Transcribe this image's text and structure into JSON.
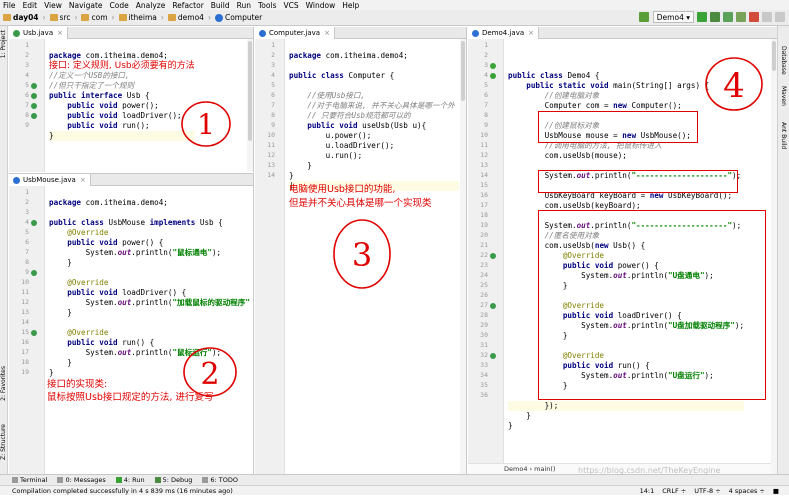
{
  "menu": [
    "File",
    "Edit",
    "View",
    "Navigate",
    "Code",
    "Analyze",
    "Refactor",
    "Build",
    "Run",
    "Tools",
    "VCS",
    "Window",
    "Help"
  ],
  "breadcrumbs": [
    "day04",
    "src",
    "com",
    "itheima",
    "demo4",
    "Computer"
  ],
  "run_config": "Demo4 ▾",
  "left_strip": {
    "project": "1: Project",
    "structure": "Z: Structure",
    "favorites": "2: Favorites"
  },
  "right_strip": {
    "database": "Database",
    "maven": "Maven",
    "ant": "Ant Build"
  },
  "pane1": {
    "tab": "Usb.java",
    "lines": [
      "1",
      "2",
      "3",
      "4",
      "5",
      "6",
      "7",
      "8",
      "9"
    ],
    "code": {
      "l1a": "package ",
      "l1b": "com.itheima.demo4;",
      "l2": "接口: 定义规则, Usb必须要有的方法",
      "l3": "//定义一个USB的接口,",
      "l4": "//但只干指定了一个规则",
      "l5a": "public interface ",
      "l5b": "Usb {",
      "l6a": "    public void ",
      "l6b": "power();",
      "l7a": "    public void ",
      "l7b": "loadDriver();",
      "l8a": "    public void ",
      "l8b": "run();",
      "l9": "}"
    }
  },
  "pane2": {
    "tab": "UsbMouse.java",
    "lines": [
      "1",
      "2",
      "3",
      "4",
      "5",
      "6",
      "7",
      "8",
      "9",
      "10",
      "11",
      "12",
      "13",
      "14",
      "15",
      "16",
      "17",
      "18",
      "19"
    ],
    "code": {
      "l1a": "package ",
      "l1b": "com.itheima.demo4;",
      "l3a": "public class ",
      "l3b": "UsbMouse ",
      "l3c": "implements ",
      "l3d": "Usb {",
      "l4": "    @Override",
      "l5a": "    public void ",
      "l5b": "power() {",
      "l6a": "        System.",
      "l6b": "out",
      "l6c": ".println(",
      "l6d": "\"鼠标通电\"",
      "l6e": ");",
      "l7": "    }",
      "l9": "    @Override",
      "l10a": "    public void ",
      "l10b": "loadDriver() {",
      "l11a": "        System.",
      "l11b": "out",
      "l11c": ".println(",
      "l11d": "\"加载鼠标的驱动程序\"",
      "l12": "    }",
      "l14": "    @Override",
      "l15a": "    public void ",
      "l15b": "run() {",
      "l16a": "        System.",
      "l16b": "out",
      "l16c": ".println(",
      "l16d": "\"鼠标运行\"",
      "l16e": ");",
      "l17": "    }",
      "l18": "}"
    },
    "annot1": "接口的实现类:",
    "annot2": "鼠标按照Usb接口规定的方法, 进行复写"
  },
  "pane3": {
    "tab": "Computer.java",
    "lines": [
      "1",
      "2",
      "3",
      "4",
      "5",
      "6",
      "7",
      "8",
      "9",
      "10",
      "11",
      "12",
      "13",
      "14"
    ],
    "code": {
      "l1a": "package ",
      "l1b": "com.itheima.demo4;",
      "l3a": "public class ",
      "l3b": "Computer {",
      "l5": "    //使用Usb接口,",
      "l6": "    //对于电脑来说, 并不关心具体是哪一个外",
      "l7": "    // 只要符合Usb规范都可以的",
      "l8a": "    public void ",
      "l8b": "useUsb(Usb u){",
      "l9": "        u.power();",
      "l10": "        u.loadDriver();",
      "l11": "        u.run();",
      "l12": "    }",
      "l13": "}"
    },
    "annot1": "电脑使用Usb接口的功能,",
    "annot2": "但是并不关心具体是哪一个实现类"
  },
  "pane4": {
    "tab": "Demo4.java",
    "lines": [
      "1",
      "2",
      "3",
      "4",
      "5",
      "6",
      "7",
      "8",
      "9",
      "10",
      "11",
      "12",
      "13",
      "14",
      "15",
      "16",
      "17",
      "18",
      "19",
      "20",
      "21",
      "22",
      "23",
      "24",
      "25",
      "26",
      "27",
      "28",
      "29",
      "30",
      "31",
      "32",
      "33",
      "34",
      "35",
      "36"
    ],
    "code": {
      "l3a": "public class ",
      "l3b": "Demo4 {",
      "l4a": "    public static void ",
      "l4b": "main(String[] args) {",
      "l5": "        //创建电脑对象",
      "l6a": "        Computer com = ",
      "l6b": "new ",
      "l6c": "Computer();",
      "l8": "        //创建鼠标对象",
      "l9a": "        UsbMouse mouse = ",
      "l9b": "new ",
      "l9c": "UsbMouse();",
      "l10": "        //调用电脑的方法, 把鼠标传进入",
      "l11": "        com.useUsb(mouse);",
      "l13a": "        System.",
      "l13b": "out",
      "l13c": ".println(",
      "l13d": "\"--------------------\"",
      "l13e": ");",
      "l15a": "        UsbKeyBoard keyBoard = ",
      "l15b": "new ",
      "l15c": "UsbKeyBoard();",
      "l16": "        com.useUsb(keyBoard);",
      "l18a": "        System.",
      "l18b": "out",
      "l18c": ".println(",
      "l18d": "\"--------------------\"",
      "l18e": ");",
      "l19": "        //匿名使用对象",
      "l20a": "        com.useUsb(",
      "l20b": "new ",
      "l20c": "Usb() {",
      "l21": "            @Override",
      "l22a": "            public void ",
      "l22b": "power() {",
      "l23a": "                System.",
      "l23b": "out",
      "l23c": ".println(",
      "l23d": "\"U盘通电\"",
      "l23e": ");",
      "l24": "            }",
      "l26": "            @Override",
      "l27a": "            public void ",
      "l27b": "loadDriver() {",
      "l28a": "                System.",
      "l28b": "out",
      "l28c": ".println(",
      "l28d": "\"U盘加载驱动程序\"",
      "l28e": ");",
      "l29": "            }",
      "l31": "            @Override",
      "l32a": "            public void ",
      "l32b": "run() {",
      "l33a": "                System.",
      "l33b": "out",
      "l33c": ".println(",
      "l33d": "\"U盘运行\"",
      "l33e": ");",
      "l34": "            }",
      "l35": "        });",
      "l36": "    }",
      "l37": "}"
    },
    "crumb": "Demo4  ›  main()"
  },
  "circles": [
    "1",
    "2",
    "3",
    "4"
  ],
  "bottom_tools": [
    "Terminal",
    "0: Messages",
    "4: Run",
    "5: Debug",
    "6: TODO"
  ],
  "status": {
    "message": "Compilation completed successfully in 4 s 839 ms (16 minutes ago)",
    "position": "14:1",
    "line_sep": "CRLF ÷",
    "encoding": "UTF-8 ÷",
    "indent": "4 spaces ÷"
  },
  "watermark": "https://blog.csdn.net/TheKeyEngine"
}
